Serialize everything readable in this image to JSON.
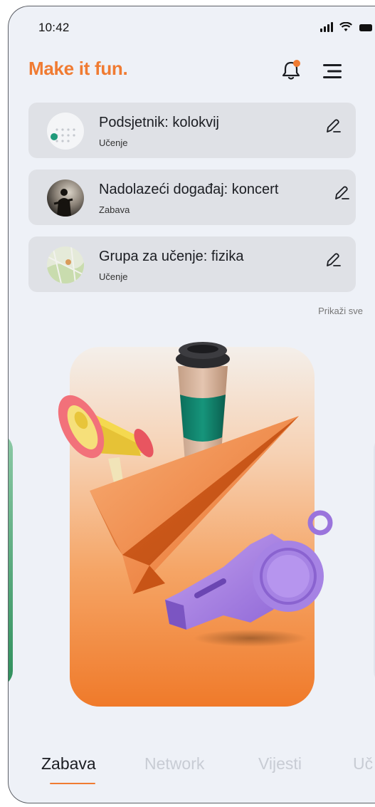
{
  "status_bar": {
    "time": "10:42",
    "icons": [
      "signal-icon",
      "wifi-icon",
      "battery-icon"
    ]
  },
  "header": {
    "brand": "Make it fun.",
    "notification_icon": "bell-icon",
    "menu_icon": "menu-icon",
    "accent_color": "#f07b32"
  },
  "cards": [
    {
      "title": "Podsjetnik: kolokvij",
      "category": "Učenje",
      "thumb": "calendar-thumbnail",
      "edit_icon": "pencil-icon"
    },
    {
      "title": "Nadolazeći događaj: koncert",
      "category": "Zabava",
      "thumb": "concert-thumbnail",
      "edit_icon": "pencil-icon"
    },
    {
      "title": "Grupa za učenje: fizika",
      "category": "Učenje",
      "thumb": "map-thumbnail",
      "edit_icon": "pencil-icon"
    }
  ],
  "see_all": "Prikaži sve",
  "hero": {
    "illustration": "megaphone-coffee-paper-plane-whistle"
  },
  "tabs": [
    {
      "label": "Zabava",
      "active": true
    },
    {
      "label": "Network",
      "active": false
    },
    {
      "label": "Vijesti",
      "active": false
    },
    {
      "label": "Uč",
      "active": false
    }
  ]
}
